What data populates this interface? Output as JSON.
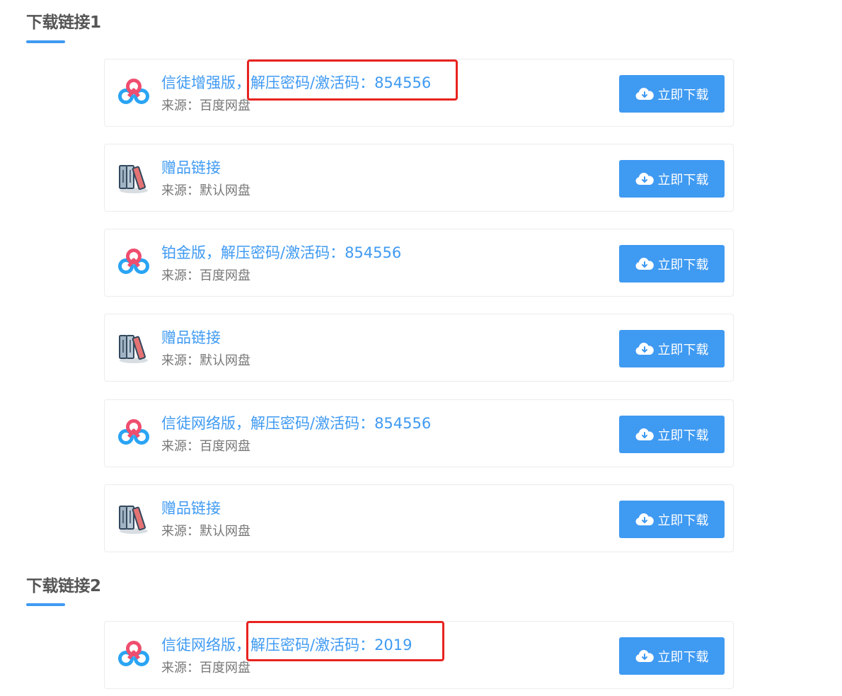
{
  "colors": {
    "accent": "#3f9af2",
    "highlight": "#e8231f",
    "title": "#555555",
    "source": "#777777"
  },
  "sections": [
    {
      "title": "下载链接1",
      "items": [
        {
          "icon": "baidu-netdisk-icon",
          "title": "信徒增强版，解压密码/激活码：854556",
          "source": "来源：百度网盘",
          "button": "立即下载"
        },
        {
          "icon": "books-icon",
          "title": "赠品链接",
          "source": "来源：默认网盘",
          "button": "立即下载"
        },
        {
          "icon": "baidu-netdisk-icon",
          "title": "铂金版，解压密码/激活码：854556",
          "source": "来源：百度网盘",
          "button": "立即下载"
        },
        {
          "icon": "books-icon",
          "title": "赠品链接",
          "source": "来源：默认网盘",
          "button": "立即下载"
        },
        {
          "icon": "baidu-netdisk-icon",
          "title": "信徒网络版，解压密码/激活码：854556",
          "source": "来源：百度网盘",
          "button": "立即下载"
        },
        {
          "icon": "books-icon",
          "title": "赠品链接",
          "source": "来源：默认网盘",
          "button": "立即下载"
        }
      ]
    },
    {
      "title": "下载链接2",
      "items": [
        {
          "icon": "baidu-netdisk-icon",
          "title": "信徒网络版，解压密码/激活码：2019",
          "source": "来源：百度网盘",
          "button": "立即下载"
        }
      ]
    }
  ]
}
